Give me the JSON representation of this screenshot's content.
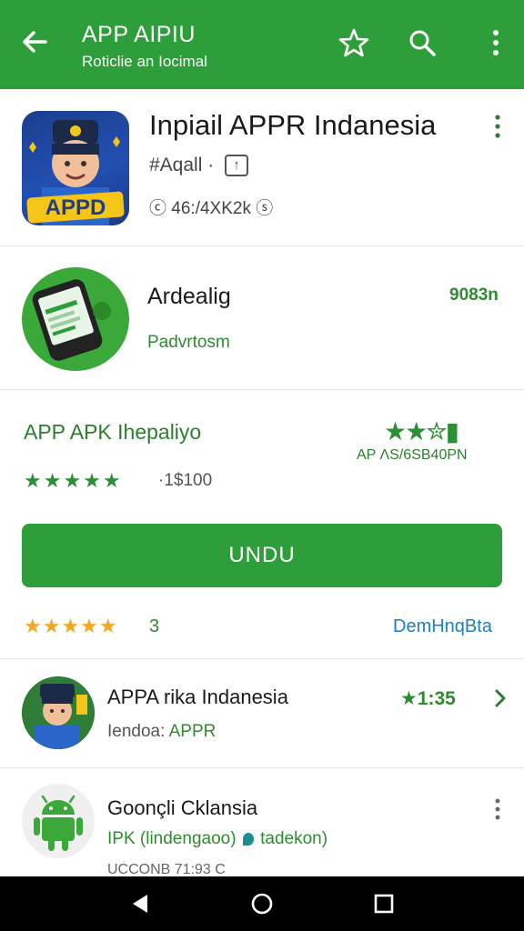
{
  "appbar": {
    "title": "APP  AIPIU",
    "subtitle": "Roticlie an Iocimal"
  },
  "app": {
    "name": "Inpiail APPR Indanesia",
    "meta1": "#Aqall ·",
    "meta2": "46:/4XK2k",
    "icon_text": "APPD"
  },
  "row2": {
    "title": "Ardealig",
    "subtitle": "Padvrtosm",
    "value": "9083n"
  },
  "row3": {
    "title": "APP  APK  Ihepaliyo",
    "stars": "★★★★★",
    "price": "·1$100",
    "right_stars": "★★✮▮",
    "right_text": "AP  ΛS/6SB40PN"
  },
  "cta": {
    "label": "UNDU"
  },
  "ratings": {
    "stars": "★★★★★",
    "count": "3",
    "link": "DemHnqBta"
  },
  "list": [
    {
      "title": "APPA rika Indanesia",
      "sub_prefix": "Iendoa: ",
      "sub_accent": "APPR",
      "rating": "★1:35"
    },
    {
      "title": "Goonçli Cklansia",
      "sub_a": "IPK (lindengaoo)",
      "sub_b": "tadekon)",
      "footer": "UCCONB 71:93 C"
    }
  ],
  "colors": {
    "primary": "#2e9e3a",
    "accent_text": "#2e8b2e",
    "link": "#1f7fbf",
    "star_orange": "#f5a623"
  }
}
